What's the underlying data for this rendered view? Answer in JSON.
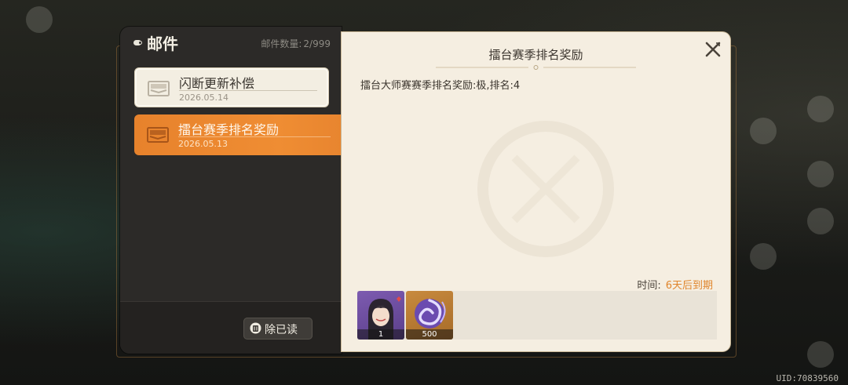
{
  "panel": {
    "title": "邮件",
    "count_label": "邮件数量:",
    "count_value": "2/999"
  },
  "mails": [
    {
      "title": "闪断更新补偿",
      "date": "2026.05.14",
      "state": "read"
    },
    {
      "title": "擂台赛季排名奖励",
      "date": "2026.05.13",
      "state": "selected"
    }
  ],
  "footer": {
    "delete_read_label": "除已读"
  },
  "detail": {
    "title": "擂台赛季排名奖励",
    "body": "擂台大师赛赛季排名奖励:极,排名:4",
    "expire_label": "时间:",
    "expire_value": "6天后到期",
    "rewards": [
      {
        "icon": "character-portrait-icon",
        "count": "1"
      },
      {
        "icon": "purple-swirl-gem-icon",
        "count": "500"
      }
    ]
  },
  "uid": "UID:70839560",
  "colors": {
    "accent": "#ef8d33",
    "expire": "#e0852c",
    "panel_dark": "#2c2a28",
    "paper": "#f5eee1"
  }
}
